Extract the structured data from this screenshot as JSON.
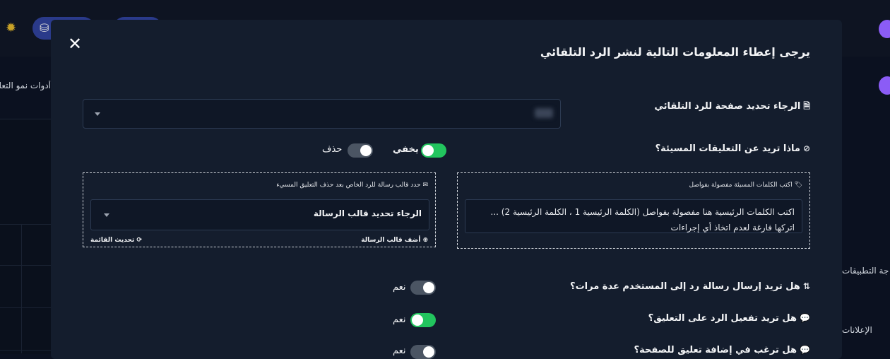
{
  "background": {
    "left_text": "أدوات نمو التعلي",
    "right_text_1": "جة التطبيقات",
    "right_text_2": "الإعلانات",
    "gear_icon": "gear-icon",
    "coins_icon": "coins-icon"
  },
  "modal": {
    "close_label": "✕",
    "title": "يرجى إعطاء المعلومات التالية لنشر الرد التلقائي",
    "page_select": {
      "label_icon": "🗎",
      "label": "الرجاء تحديد صفحة للرد التلقائي"
    },
    "offensive": {
      "label_icon": "⦸",
      "label": "ماذا تريد عن التعليقات المسيئة؟",
      "hide_label": "يخفي",
      "hide_on": true,
      "delete_label": "حذف",
      "delete_on": false
    },
    "keywords_box": {
      "head_icon": "🏷",
      "head": "اكتب الكلمات المسيئة مفصولة بفواصل",
      "text": "اكتب الكلمات الرئيسية هنا مفصولة بفواصل (الكلمة الرئيسية 1 ، الكلمة الرئيسية 2) ... اتركها فارغة لعدم اتخاذ أي إجراءات"
    },
    "template_box": {
      "head_icon": "✉",
      "head": "حدد قالب رسالة للرد الخاص بعد حذف التعليق المسيء",
      "select_text": "الرجاء تحديد قالب الرسالة",
      "add_icon": "⊕",
      "add_label": "أضف قالب الرسالة",
      "refresh_icon": "⟳",
      "refresh_label": "تحديث القائمة"
    },
    "multi_reply": {
      "label_icon": "⇅",
      "label": "هل تريد إرسال رسالة رد إلى المستخدم عدة مرات؟",
      "toggle_label": "نعم",
      "on": false
    },
    "enable_reply": {
      "label_icon": "💬",
      "label": "هل تريد تفعيل الرد على التعليق؟",
      "toggle_label": "نعم",
      "on": true
    },
    "add_comment": {
      "label_icon": "💬",
      "label": "هل ترغب في إضافة تعليق للصفحة؟",
      "toggle_label": "نعم",
      "on": false
    }
  }
}
